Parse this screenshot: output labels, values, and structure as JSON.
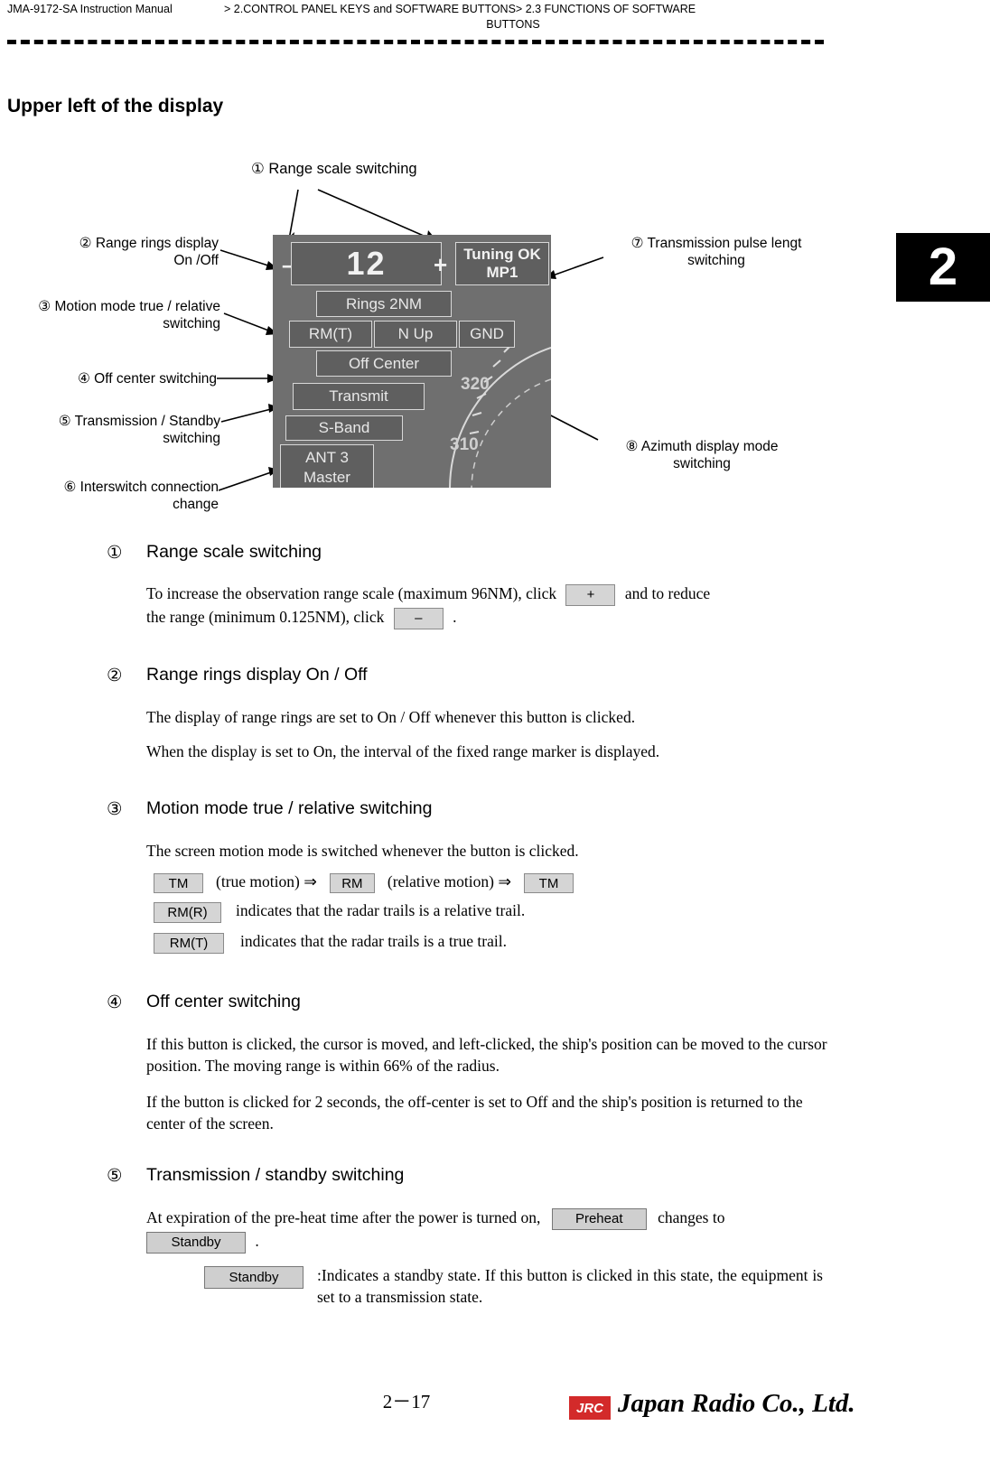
{
  "header": {
    "left": "JMA-9172-SA Instruction Manual",
    "crumb1": "2.CONTROL PANEL KEYS and SOFTWARE BUTTONS",
    "crumb2": "2.3  FUNCTIONS OF SOFTWARE",
    "crumb3": "BUTTONS",
    "gt1": ">",
    "gt2": ">",
    "chapter": "2"
  },
  "section_title": "Upper left of the display",
  "figure": {
    "top_caption": "① Range scale switching",
    "labels": [
      {
        "id": "l2",
        "text": "② Range rings display\nOn /Off"
      },
      {
        "id": "l3",
        "text": "③ Motion mode true  / relative\nswitching"
      },
      {
        "id": "l4",
        "text": "④ Off center switching"
      },
      {
        "id": "l5",
        "text": "⑤ Transmission / Standby\nswitching"
      },
      {
        "id": "l6",
        "text": "⑥ Interswitch connection\nchange"
      },
      {
        "id": "l7",
        "text": "⑦ Transmission pulse lengt\nswitching"
      },
      {
        "id": "l8",
        "text": "⑧ Azimuth display mode\nswitching"
      }
    ],
    "radar": {
      "range_value": "12",
      "minus": "–",
      "plus": "+",
      "tuning_line1": "Tuning OK",
      "tuning_line2": "MP1",
      "rings": "Rings  2NM",
      "motion_mode": "RM(T)",
      "heading": "N  Up",
      "stabilization": "GND",
      "off_center": "Off Center",
      "transmit": "Transmit",
      "band": "S-Band",
      "ant1": "ANT  3",
      "ant2": "Master",
      "bearing1": "320",
      "bearing2": "310"
    }
  },
  "items": [
    {
      "num": "①",
      "head": "Range scale switching",
      "p1a": "To increase the observation range scale (maximum 96NM), click",
      "btn_plus": "+",
      "p1b": "and to reduce",
      "p2a": "the range (minimum 0.125NM), click",
      "btn_minus": "–",
      "p2b": "."
    },
    {
      "num": "②",
      "head": "Range rings display On / Off",
      "p1": "The display of range rings are set to On / Off whenever this button is clicked.",
      "p2": "When the display is set to On, the interval of the fixed range marker is displayed."
    },
    {
      "num": "③",
      "head": "Motion mode true / relative switching",
      "p1": "The screen motion mode is switched whenever the button is clicked.",
      "btn_tm": "TM",
      "t_true": "(true motion) ⇒",
      "btn_rm": "RM",
      "t_rel": "(relative motion) ⇒",
      "btn_tm2": "TM",
      "btn_rmr": "RM(R)",
      "t_rmr": "indicates that the radar trails is a relative trail.",
      "btn_rmt": "RM(T)",
      "t_rmt": "indicates that the radar trails is a true trail."
    },
    {
      "num": "④",
      "head": "Off center switching",
      "p1": "If this button is clicked, the cursor is moved, and left-clicked, the ship's position can be moved to the cursor position. The moving range is within 66% of the radius.",
      "p2": "If the button is clicked for 2 seconds, the off-center is set to Off and the ship's position is returned to the center of the screen."
    },
    {
      "num": "⑤",
      "head": "Transmission / standby switching",
      "p1a": "At expiration of the pre-heat time after the power is turned on,",
      "btn_preheat": "Preheat",
      "p1b": "changes to",
      "btn_standby": "Standby",
      "p1c": ".",
      "btn_standby2": "Standby",
      "p2": ":Indicates a standby state. If this button is clicked in this state, the equipment is set to a transmission state."
    }
  ],
  "footer": {
    "page": "2－17",
    "logo": "JRC",
    "company": "Japan Radio Co., Ltd."
  }
}
